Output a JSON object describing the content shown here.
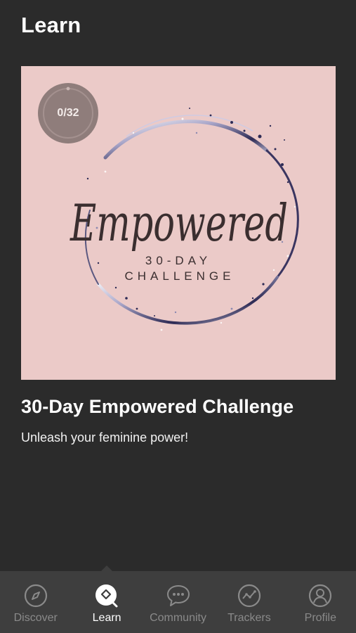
{
  "header": {
    "title": "Learn"
  },
  "course": {
    "progress": "0/32",
    "cover": {
      "script_word": "Empowered",
      "line1": "30-DAY",
      "line2": "CHALLENGE"
    },
    "title": "30-Day Empowered Challenge",
    "subtitle": "Unleash your feminine power!"
  },
  "colors": {
    "background": "#2b2b2b",
    "cover_background": "#ebcac8",
    "badge": "#8f7d7b",
    "nav_background": "#3e3e3e",
    "nav_inactive": "#8a8a8a",
    "nav_active": "#ffffff"
  },
  "nav": {
    "items": [
      {
        "label": "Discover",
        "icon": "compass-icon",
        "active": false
      },
      {
        "label": "Learn",
        "icon": "learn-icon",
        "active": true
      },
      {
        "label": "Community",
        "icon": "chat-bubble-icon",
        "active": false
      },
      {
        "label": "Trackers",
        "icon": "tracker-icon",
        "active": false
      },
      {
        "label": "Profile",
        "icon": "profile-icon",
        "active": false
      }
    ]
  }
}
